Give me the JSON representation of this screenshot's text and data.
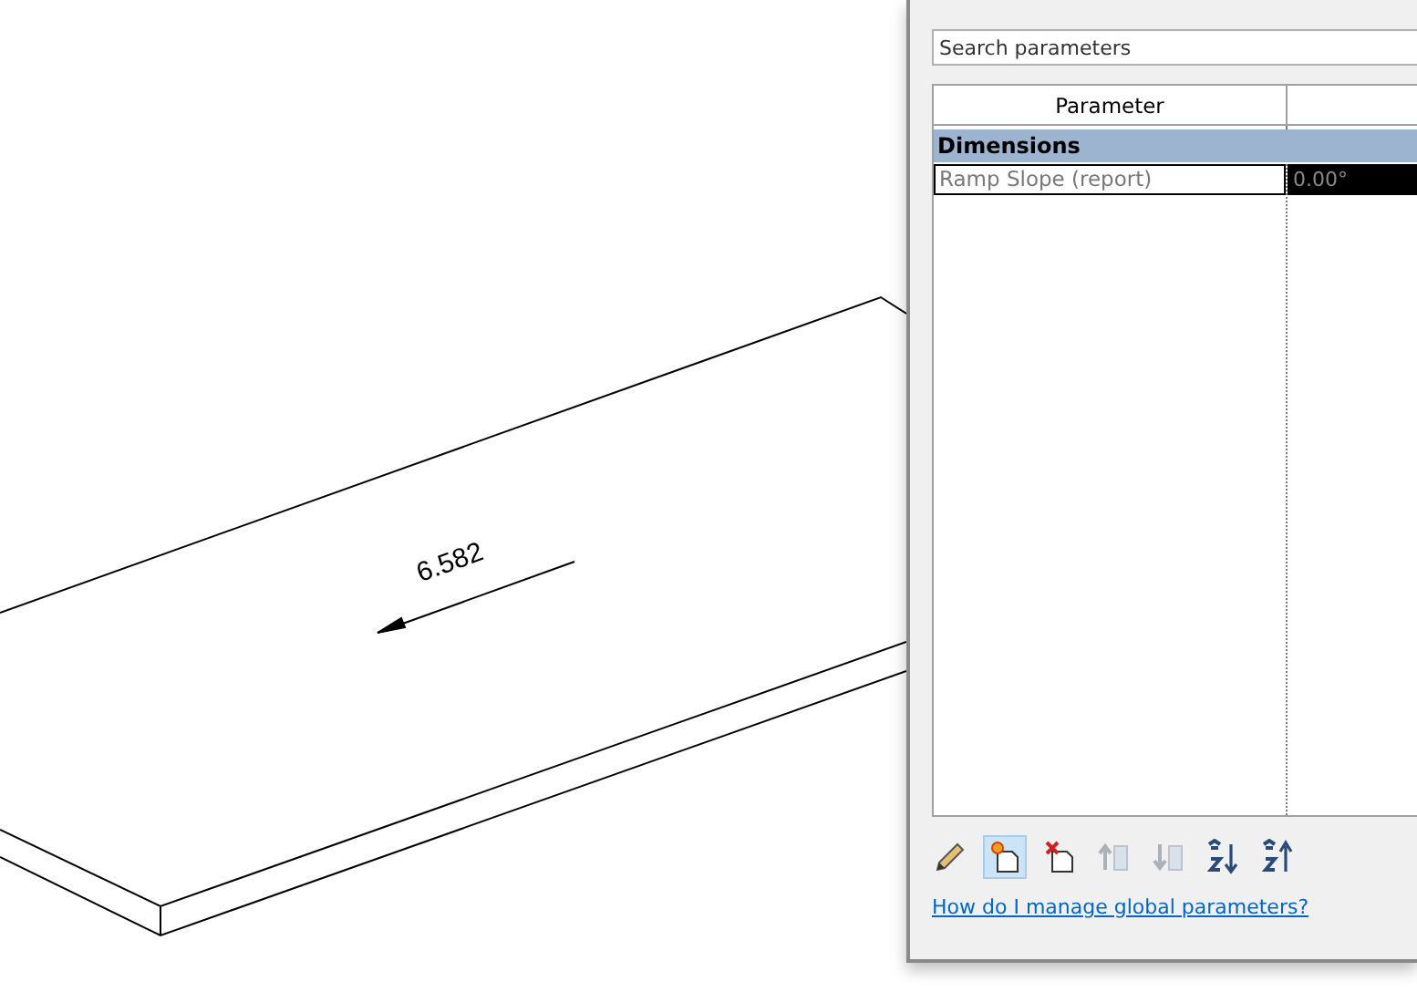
{
  "drawing": {
    "dimension": "6.582"
  },
  "panel": {
    "search": {
      "placeholder": "Search parameters"
    },
    "table": {
      "columns": [
        "Parameter"
      ],
      "groups": [
        {
          "name": "Dimensions",
          "rows": [
            {
              "parameter": "Ramp Slope (report)",
              "value": "0.00°",
              "selected": true
            }
          ]
        }
      ]
    },
    "toolbar": [
      {
        "kind": "edit",
        "disabled": false,
        "selected": false
      },
      {
        "kind": "new",
        "disabled": false,
        "selected": true
      },
      {
        "kind": "delete",
        "disabled": false,
        "selected": false
      },
      {
        "kind": "up",
        "disabled": true,
        "selected": false
      },
      {
        "kind": "down",
        "disabled": true,
        "selected": false
      },
      {
        "kind": "sort-asc",
        "disabled": false,
        "selected": false
      },
      {
        "kind": "sort-desc",
        "disabled": false,
        "selected": false
      }
    ],
    "help_link": "How do I manage global parameters?"
  }
}
